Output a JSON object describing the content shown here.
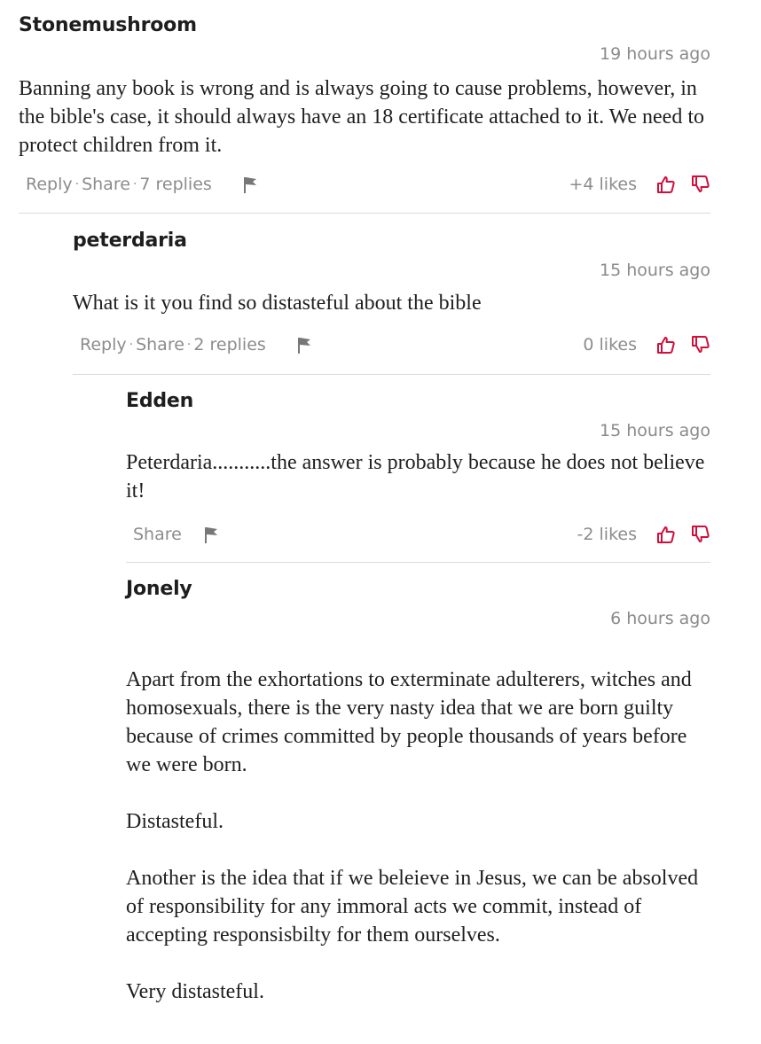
{
  "colors": {
    "vote": "#d0103a",
    "divider": "#dcdcdc",
    "meta": "#8a8a8a"
  },
  "comments": [
    {
      "author": "Stonemushroom",
      "time": "19 hours ago",
      "paragraphs": [
        "Banning any book is wrong and is always going to cause problems, however, in the bible's case, it should always have an 18 certificate attached to it. We need to protect children from it."
      ],
      "reply_label": "Reply",
      "share_label": "Share",
      "replies_label": "7 replies",
      "likes": "+4 likes"
    },
    {
      "author": "peterdaria",
      "time": "15 hours ago",
      "paragraphs": [
        "What is it you find so distasteful about the bible"
      ],
      "reply_label": "Reply",
      "share_label": "Share",
      "replies_label": "2 replies",
      "likes": "0 likes"
    },
    {
      "author": "Edden",
      "time": "15 hours ago",
      "paragraphs": [
        "Peterdaria...........the answer is probably because he does not believe it!"
      ],
      "share_label": "Share",
      "likes": "-2 likes"
    },
    {
      "author": "Jonely",
      "time": "6 hours ago",
      "paragraphs": [
        "Apart from the exhortations to exterminate adulterers, witches and homosexuals, there is the very nasty idea that we are born guilty because of crimes committed by people thousands of years before we were born.",
        "Distasteful.",
        "Another is the idea that if we beleieve in Jesus, we can be absolved of responsibility for any immoral acts we commit, instead of accepting responsisbilty for them ourselves.",
        "Very distasteful."
      ]
    }
  ]
}
